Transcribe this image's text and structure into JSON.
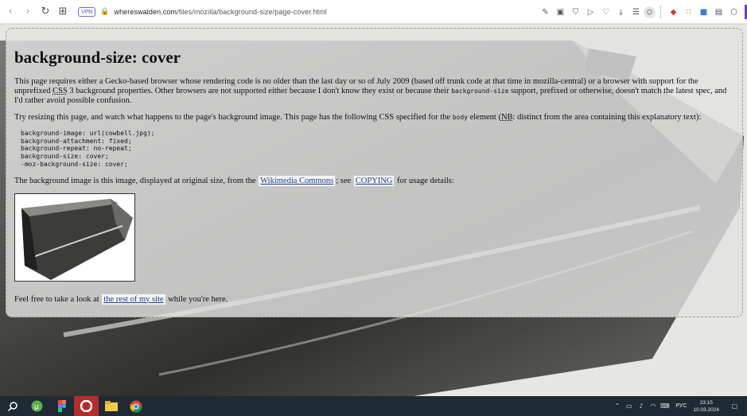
{
  "browser": {
    "vpn_label": "VPN",
    "url_host": "whereswalden.com",
    "url_path": "/files/mozilla/background-size/page-cover.html"
  },
  "page": {
    "title": "background-size: cover",
    "intro_a": "This page requires either a Gecko-based browser whose rendering code is no older than the last day or so of July 2009 (based off trunk code at that time in mozilla-central) or a browser with support for the unprefixed ",
    "intro_css": "CSS",
    "intro_b": " 3 background properties. Other browsers are not supported either because I don't know they exist or because their ",
    "intro_code": "background-size",
    "intro_c": " support, prefixed or otherwise, doesn't match the latest spec, and I'd rather avoid possible confusion.",
    "resize_a": "Try resizing this page, and watch what happens to the page's background image. This page has the following CSS specified for the ",
    "resize_code": "body",
    "resize_b": " element (",
    "resize_nb": "NB",
    "resize_c": ": distinct from the area containing this explanatory text):",
    "css_code": "background-image: url(cowbell.jpg);\nbackground-attachment: fixed;\nbackground-repeat: no-repeat;\nbackground-size: cover;\n-moz-background-size: cover;",
    "image_a": "The background image is this image, displayed at original size, from the ",
    "image_link1": "Wikimedia Commons",
    "image_b": "; see ",
    "image_link2": "COPYING",
    "image_c": " for usage details:",
    "footer_a": "Feel free to take a look at ",
    "footer_link": "the rest of my site",
    "footer_b": " while you're here."
  },
  "taskbar": {
    "lang": "РУС",
    "time": "23:15",
    "date": "10.03.2024"
  },
  "colors": {
    "link": "#1a3f8a",
    "taskbar": "#1f2b34",
    "active_app": "#b62c2c"
  }
}
